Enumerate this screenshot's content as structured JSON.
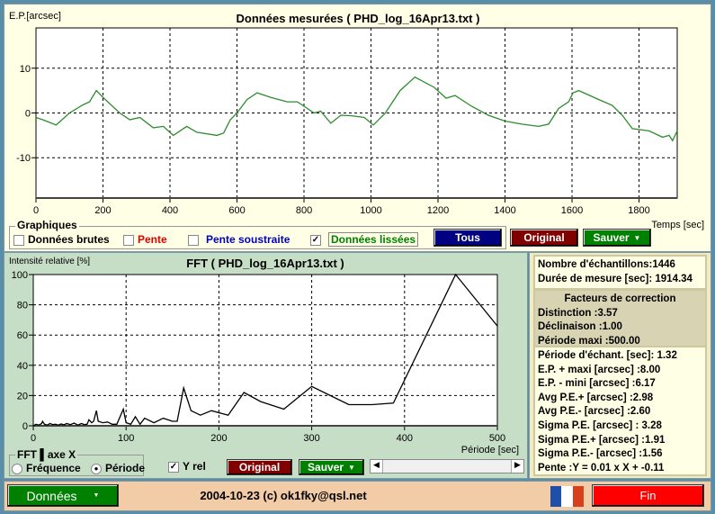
{
  "pe_chart": {
    "title": "Données mesurées ( PHD_log_16Apr13.txt )",
    "ylabel": "E.P.[arcsec]",
    "xlabel": "Temps [sec]"
  },
  "graphics": {
    "legend": "Graphiques",
    "raw": "Données brutes",
    "slope": "Pente",
    "slope_sub": "Pente soustraite",
    "smoothed": "Données lissées",
    "raw_checked": false,
    "slope_checked": false,
    "slope_sub_checked": false,
    "smoothed_checked": true
  },
  "top_buttons": {
    "all": "Tous",
    "original": "Original",
    "save": "Sauver"
  },
  "fft_chart": {
    "title": "FFT ( PHD_log_16Apr13.txt )",
    "ylabel": "Intensité relative [%]",
    "xlabel": "Période [sec]"
  },
  "fft_axis": {
    "legend": "FFT ▌axe X",
    "freq": "Fréquence",
    "period": "Période",
    "selected": "period",
    "yrel": "Y rel",
    "yrel_checked": true,
    "original": "Original",
    "save": "Sauver"
  },
  "info": {
    "samples": "Nombre d'échantillons:1446",
    "duration": "Durée de mesure [sec]: 1914.34"
  },
  "correction": {
    "title": "Facteurs de correction",
    "distinction": "Distinction :3.57",
    "declination": "Déclinaison :1.00",
    "max_period": "Période maxi :500.00"
  },
  "stats": [
    "Période d'échant. [sec]: 1.32",
    "E.P. + maxi [arcsec] :8.00",
    "E.P. - mini [arcsec] :6.17",
    "Avg P.E.+ [arcsec] :2.98",
    "Avg P.E.- [arcsec] :2.60",
    "Sigma P.E. [arcsec] : 3.28",
    "Sigma P.E.+ [arcsec] :1.91",
    "Sigma P.E.- [arcsec] :1.56",
    "Pente :Y = 0.01 x X + -0.11"
  ],
  "bottom": {
    "data_button": "Données",
    "copyright": "2004-10-23 (c) ok1fky@qsl.net",
    "exit": "Fin"
  },
  "colors": {
    "smoothed": "#2e8b2e",
    "fft": "#000000",
    "all_btn": "#000080",
    "original_btn": "#800000",
    "save_btn": "#008000",
    "exit_btn": "#ff0000"
  },
  "chart_data": [
    {
      "type": "line",
      "title": "Données mesurées ( PHD_log_16Apr13.txt )",
      "xlabel": "Temps [sec]",
      "ylabel": "E.P.[arcsec]",
      "xlim": [
        0,
        1914
      ],
      "ylim": [
        -19,
        19
      ],
      "xticks": [
        0,
        200,
        400,
        600,
        800,
        1000,
        1200,
        1400,
        1600,
        1800
      ],
      "yticks": [
        10,
        0,
        -10
      ],
      "grid": true,
      "x": [
        0,
        20,
        60,
        100,
        140,
        160,
        180,
        200,
        250,
        280,
        310,
        350,
        380,
        410,
        450,
        480,
        540,
        560,
        580,
        600,
        630,
        660,
        700,
        750,
        780,
        800,
        830,
        850,
        880,
        910,
        940,
        980,
        1007,
        1043,
        1087,
        1131,
        1189,
        1224,
        1251,
        1300,
        1350,
        1400,
        1450,
        1500,
        1530,
        1560,
        1590,
        1603,
        1620,
        1680,
        1720,
        1750,
        1780,
        1830,
        1870,
        1890,
        1900,
        1914
      ],
      "y": [
        -1,
        -1.5,
        -2.7,
        0,
        1.8,
        2.5,
        5,
        3.5,
        0,
        -1.5,
        -1,
        -3.3,
        -3,
        -5,
        -3,
        -4.3,
        -5,
        -4.5,
        -1.5,
        0,
        3,
        4.5,
        3.5,
        2.5,
        2.5,
        1.5,
        0,
        0.4,
        -2.3,
        -0.5,
        -0.6,
        -1,
        -2.7,
        0,
        5,
        8,
        5.7,
        3.3,
        3.9,
        1.5,
        -0.5,
        -1.8,
        -2.5,
        -3,
        -2.5,
        1,
        2.5,
        4.5,
        5,
        3,
        1.7,
        -0.5,
        -3.5,
        -4,
        -5.4,
        -5,
        -6.2,
        -4
      ]
    },
    {
      "type": "line",
      "title": "FFT ( PHD_log_16Apr13.txt )",
      "xlabel": "Période [sec]",
      "ylabel": "Intensité relative [%]",
      "xlim": [
        0,
        500
      ],
      "ylim": [
        0,
        100
      ],
      "xticks": [
        0,
        100,
        200,
        300,
        400,
        500
      ],
      "yticks": [
        0,
        20,
        40,
        60,
        80,
        100
      ],
      "grid": true,
      "x": [
        0,
        3,
        6,
        9,
        10,
        12,
        15,
        18,
        21,
        24,
        27,
        30,
        33,
        36,
        40,
        44,
        48,
        52,
        55,
        58,
        60,
        63,
        65,
        68,
        70,
        75,
        80,
        85,
        90,
        97,
        100,
        105,
        110,
        115,
        120,
        130,
        140,
        150,
        155,
        162,
        170,
        180,
        192,
        210,
        227,
        245,
        270,
        300,
        340,
        365,
        388,
        455,
        500
      ],
      "y": [
        0,
        1,
        0.5,
        1.5,
        3,
        1,
        0.5,
        1.5,
        0.8,
        1,
        0.5,
        1.2,
        0.6,
        1.5,
        0.8,
        1.8,
        0.5,
        1.5,
        0.8,
        1,
        4,
        2,
        3,
        10,
        3,
        2,
        2.5,
        1,
        1,
        11,
        2,
        1,
        6,
        1,
        5,
        2,
        5,
        3,
        3,
        25,
        10,
        7,
        10,
        7,
        22,
        16,
        11,
        26,
        14,
        14,
        15,
        100,
        66
      ]
    }
  ]
}
